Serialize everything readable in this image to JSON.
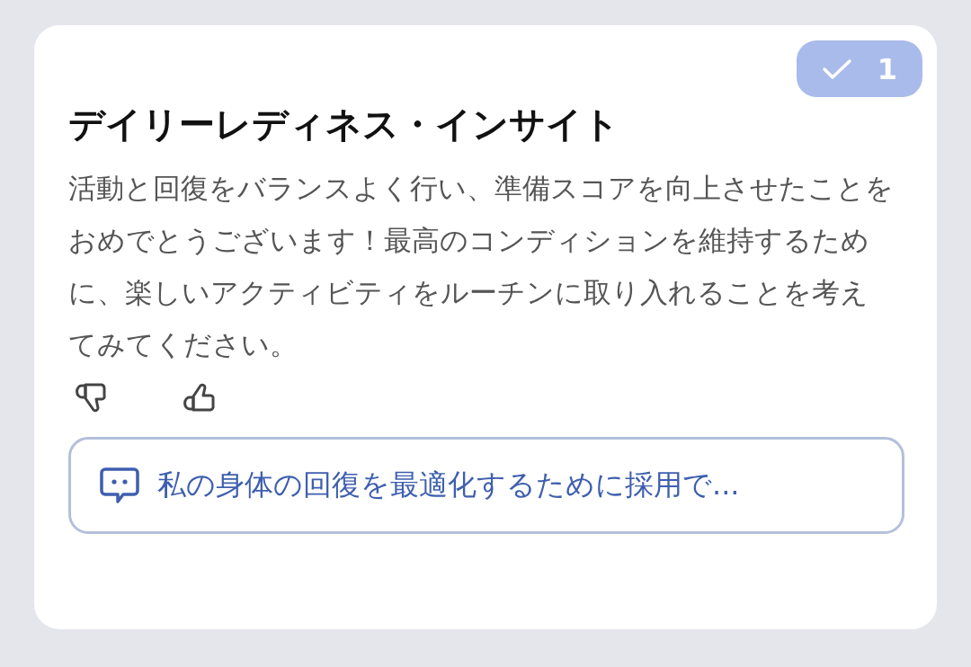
{
  "badge": {
    "count": "1",
    "checked": true
  },
  "title": "デイリーレディネス・インサイト",
  "body": "活動と回復をバランスよく行い、準備スコアを向上させたことをおめでとうございます！最高のコンディションを維持するために、楽しいアクティビティをルーチンに取り入れることを考えてみてください。",
  "suggestion": "私の身体の回復を最適化するために採用で..."
}
